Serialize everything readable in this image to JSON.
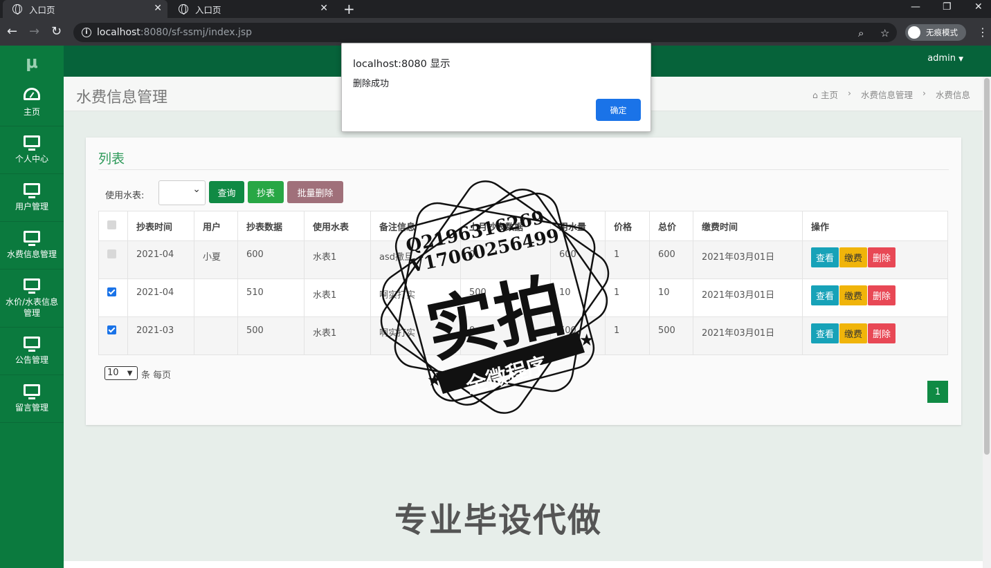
{
  "browser": {
    "tabs": [
      {
        "label": "入口页"
      },
      {
        "label": "入口页"
      }
    ],
    "url_host": "localhost",
    "url_rest": ":8080/sf-ssmj/index.jsp",
    "incognito_label": "无痕模式"
  },
  "sidebar": {
    "logo": "μ",
    "items": [
      {
        "label": "主页",
        "icon": "dashboard-icon"
      },
      {
        "label": "个人中心",
        "icon": "monitor-icon"
      },
      {
        "label": "用户管理",
        "icon": "monitor-icon"
      },
      {
        "label": "水费信息管理",
        "icon": "monitor-icon"
      },
      {
        "label": "水价/水表信息管理",
        "icon": "monitor-icon"
      },
      {
        "label": "公告管理",
        "icon": "monitor-icon"
      },
      {
        "label": "留言管理",
        "icon": "monitor-icon"
      }
    ]
  },
  "header": {
    "user": "admin"
  },
  "page": {
    "title": "水费信息管理",
    "breadcrumb": [
      "主页",
      "水费信息管理",
      "水费信息"
    ]
  },
  "panel": {
    "title": "列表",
    "search_label": "使用水表:",
    "buttons": {
      "query": "查询",
      "meter": "抄表",
      "batch_delete": "批量删除"
    },
    "columns": [
      "抄表时间",
      "用户",
      "抄表数据",
      "使用水表",
      "备注信息",
      "上月抄表数据",
      "用水量",
      "价格",
      "总价",
      "缴费时间",
      "操作"
    ],
    "rows": [
      {
        "checked": false,
        "cells": [
          "2021-04",
          "小夏",
          "600",
          "水表1",
          "asd撒旦",
          "0",
          "600",
          "1",
          "600",
          "2021年03月01日"
        ]
      },
      {
        "checked": true,
        "cells": [
          "2021-04",
          "",
          "510",
          "水表1",
          "啊实打实",
          "500",
          "10",
          "1",
          "10",
          "2021年03月01日"
        ]
      },
      {
        "checked": true,
        "cells": [
          "2021-03",
          "",
          "500",
          "水表1",
          "啊实打实",
          "0",
          "500",
          "1",
          "500",
          "2021年03月01日"
        ]
      }
    ],
    "actions": {
      "view": "查看",
      "pay": "缴费",
      "delete": "删除"
    },
    "page_size": "10",
    "page_size_suffix": "条 每页",
    "current_page": "1"
  },
  "dialog": {
    "title": "localhost:8080 显示",
    "message": "删除成功",
    "ok": "确定"
  },
  "watermark": {
    "line1": "Q2196316269",
    "line2": "V17060256499",
    "big": "实拍",
    "banner": "全微程序",
    "promo": "专业毕设代做"
  }
}
